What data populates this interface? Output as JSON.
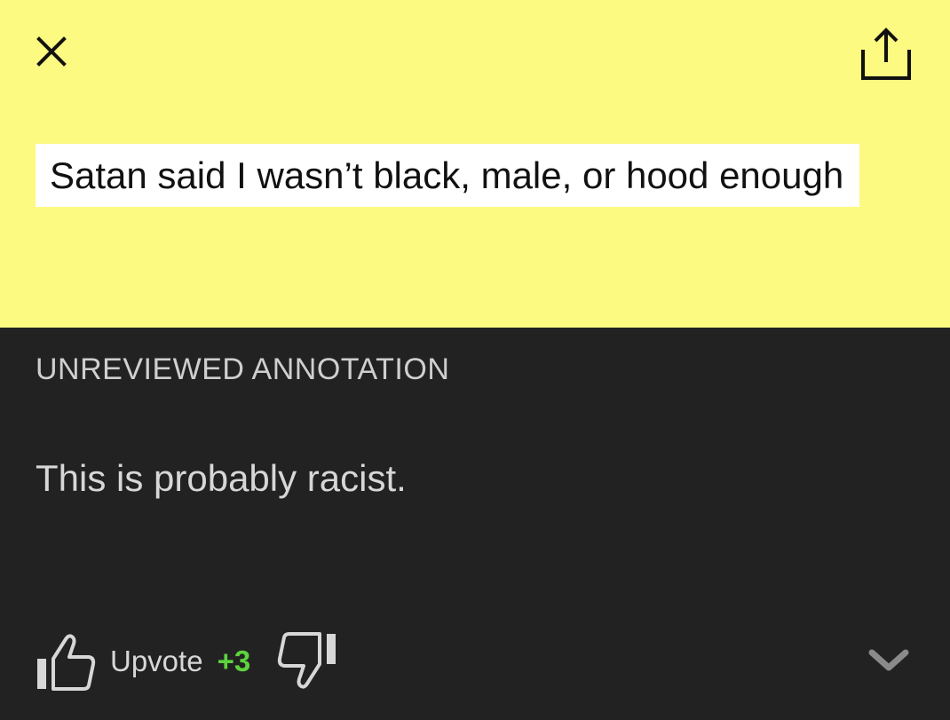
{
  "lyric": {
    "text": "Satan said I wasn’t black, male, or hood enough"
  },
  "annotation": {
    "status_label": "UNREVIEWED ANNOTATION",
    "body": "This is probably racist.",
    "upvote_label": "Upvote",
    "vote_count": "+3"
  },
  "icons": {
    "close": "close-icon",
    "share": "share-icon",
    "thumbs_up": "thumbs-up-icon",
    "thumbs_down": "thumbs-down-icon",
    "expand": "chevron-down-icon"
  },
  "colors": {
    "highlight_background": "#fcfa80",
    "lyric_background": "#ffffff",
    "panel_background": "#222222",
    "vote_count": "#5ed23e"
  }
}
